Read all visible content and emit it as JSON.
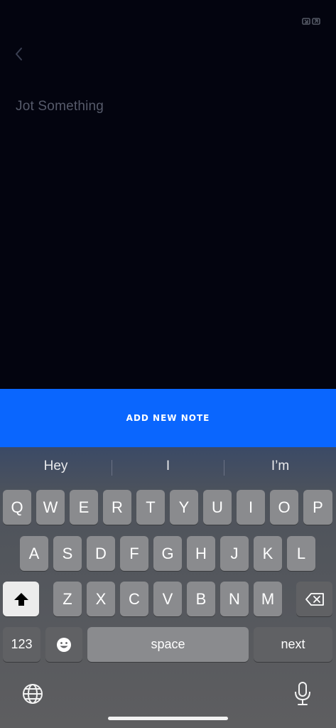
{
  "editor": {
    "placeholder": "Jot Something"
  },
  "actions": {
    "add_note_label": "ADD NEW NOTE"
  },
  "keyboard": {
    "suggestions": [
      "Hey",
      "I",
      "I’m"
    ],
    "row1": [
      "Q",
      "W",
      "E",
      "R",
      "T",
      "Y",
      "U",
      "I",
      "O",
      "P"
    ],
    "row2": [
      "A",
      "S",
      "D",
      "F",
      "G",
      "H",
      "J",
      "K",
      "L"
    ],
    "row3": [
      "Z",
      "X",
      "C",
      "V",
      "B",
      "N",
      "M"
    ],
    "numbers_label": "123",
    "space_label": "space",
    "return_label": "next"
  },
  "icons": {
    "status": "expand-arrows-icon",
    "back": "chevron-left-icon",
    "emoji": "emoji-icon",
    "shift": "shift-icon",
    "delete": "delete-backspace-icon",
    "globe": "globe-icon",
    "mic": "microphone-icon"
  },
  "colors": {
    "background": "#03040f",
    "accent": "#0a66fe",
    "placeholder": "#565a6a"
  }
}
